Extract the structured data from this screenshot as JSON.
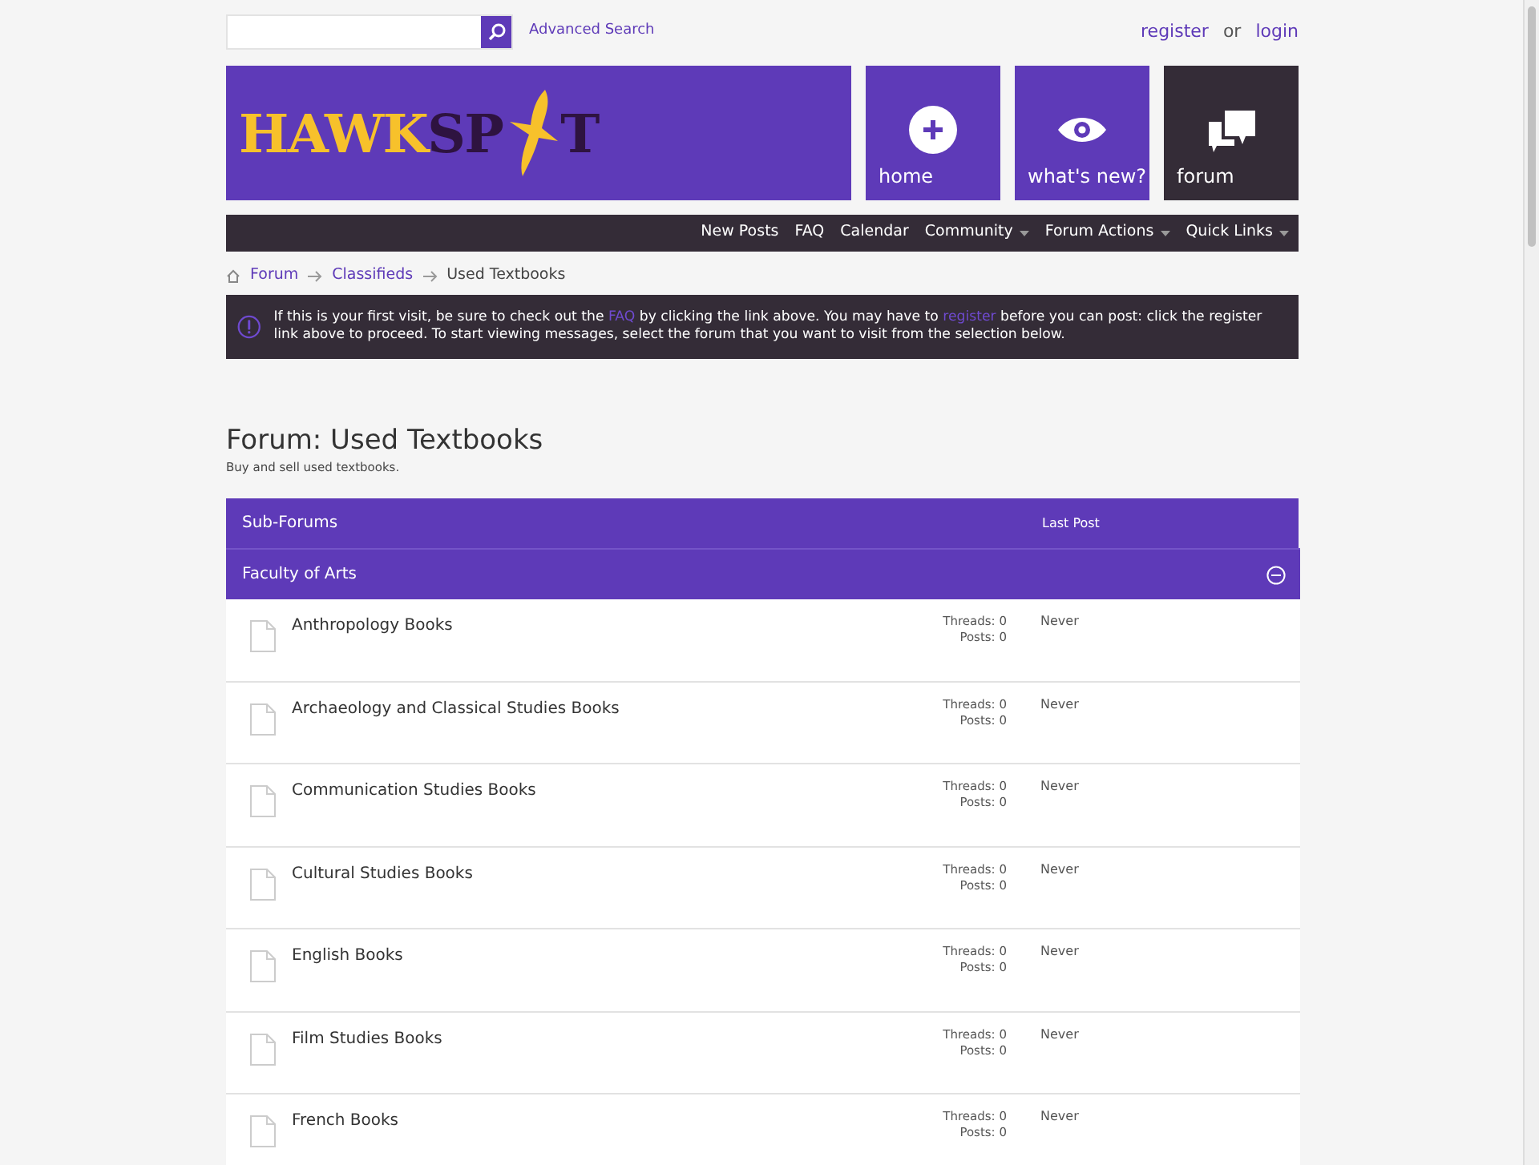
{
  "search": {
    "advanced_link": "Advanced Search"
  },
  "account": {
    "register": "register",
    "separator": "or",
    "login": "login"
  },
  "logo": {
    "part_1": "HAWK",
    "part_2": "SP",
    "part_3": "T"
  },
  "tiles": [
    {
      "kind": "plus",
      "label": "home",
      "selected": false
    },
    {
      "kind": "eye",
      "label": "what's new?",
      "selected": false
    },
    {
      "kind": "chat",
      "label": "forum",
      "selected": true
    }
  ],
  "navbar": [
    {
      "label": "New Posts",
      "menu": false
    },
    {
      "label": "FAQ",
      "menu": false
    },
    {
      "label": "Calendar",
      "menu": false
    },
    {
      "label": "Community",
      "menu": true
    },
    {
      "label": "Forum Actions",
      "menu": true
    },
    {
      "label": "Quick Links",
      "menu": true
    }
  ],
  "breadcrumb": [
    "Forum",
    "Classifieds",
    "Used Textbooks"
  ],
  "notice": [
    {
      "kind": "text",
      "text": "If this is your first visit, be sure to check out the"
    },
    {
      "kind": "link",
      "text": "FAQ"
    },
    {
      "kind": "text",
      "text": "by clicking the link above. You may have to"
    },
    {
      "kind": "link",
      "text": "register"
    },
    {
      "kind": "text",
      "text": "before you can post: click the register link above to proceed. To start viewing messages, select the forum that you want to visit from the selection below."
    }
  ],
  "page_title": "Forum: Used Textbooks",
  "page_description": "Buy and sell used textbooks.",
  "table": {
    "columns": [
      "Sub-Forums",
      "Last Post"
    ],
    "section": {
      "title": "Faculty of Arts",
      "expanded": true
    },
    "rows": [
      {
        "name": "Anthropology Books",
        "threads": "Threads: 0",
        "posts": "Posts: 0",
        "last_post": "Never"
      },
      {
        "name": "Archaeology and Classical Studies Books",
        "threads": "Threads: 0",
        "posts": "Posts: 0",
        "last_post": "Never"
      },
      {
        "name": "Communication Studies Books",
        "threads": "Threads: 0",
        "posts": "Posts: 0",
        "last_post": "Never"
      },
      {
        "name": "Cultural Studies Books",
        "threads": "Threads: 0",
        "posts": "Posts: 0",
        "last_post": "Never"
      },
      {
        "name": "English Books",
        "threads": "Threads: 0",
        "posts": "Posts: 0",
        "last_post": "Never"
      },
      {
        "name": "Film Studies Books",
        "threads": "Threads: 0",
        "posts": "Posts: 0",
        "last_post": "Never"
      },
      {
        "name": "French Books",
        "threads": "Threads: 0",
        "posts": "Posts: 0",
        "last_post": "Never"
      }
    ]
  }
}
